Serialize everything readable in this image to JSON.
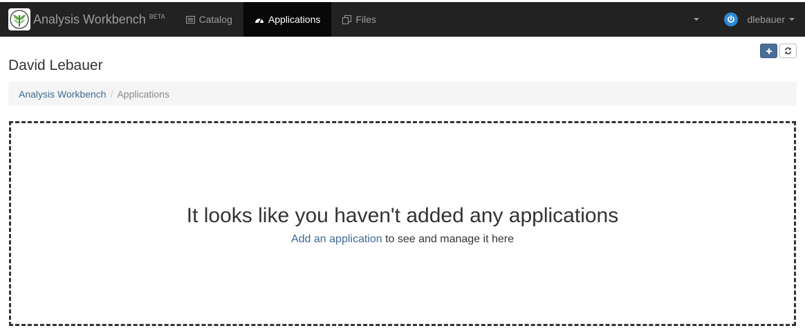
{
  "brand": {
    "name": "Analysis Workbench",
    "badge": "BETA"
  },
  "nav": {
    "items": [
      {
        "label": "Catalog",
        "icon": "list-icon",
        "active": false
      },
      {
        "label": "Applications",
        "icon": "dashboard-icon",
        "active": true
      },
      {
        "label": "Files",
        "icon": "files-icon",
        "active": false
      }
    ]
  },
  "user": {
    "name": "dlebauer",
    "icon": "power-icon",
    "icon_color": "#2e8ad6"
  },
  "page": {
    "title": "David Lebauer"
  },
  "toolbar": {
    "add_icon": "plus-icon",
    "refresh_icon": "refresh-icon",
    "add_color": "#4a6f96"
  },
  "breadcrumb": {
    "items": [
      {
        "label": "Analysis Workbench"
      },
      {
        "label": "Applications"
      }
    ],
    "separator": "/"
  },
  "empty_state": {
    "title": "It looks like you haven't added any applications",
    "link_text": "Add an application",
    "suffix_text": " to see and manage it here"
  },
  "colors": {
    "navbar": "#222222",
    "active_tab": "#080808",
    "link": "#3f6a93"
  }
}
